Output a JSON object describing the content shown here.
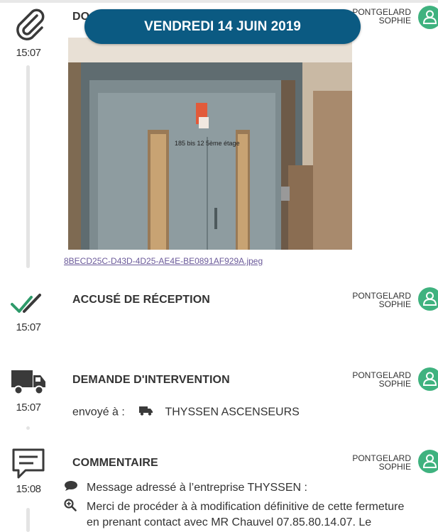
{
  "date_banner": "VENDREDI 14 JUIN 2019",
  "entries": [
    {
      "icon": "paperclip-icon",
      "time": "15:07",
      "title": "DO",
      "author_line1": "PONTGELARD",
      "author_line2": "SOPHIE",
      "attachment_name": "8BECD25C-D43D-4D25-AE4E-BE0891AF929A.jpeg",
      "photo_caption": "185 bis 12 5ème étage"
    },
    {
      "icon": "double-check-icon",
      "time": "15:07",
      "title": "ACCUSÉ DE RÉCEPTION",
      "author_line1": "PONTGELARD",
      "author_line2": "SOPHIE"
    },
    {
      "icon": "truck-icon",
      "time": "15:07",
      "title": "DEMANDE D'INTERVENTION",
      "author_line1": "PONTGELARD",
      "author_line2": "SOPHIE",
      "sent_label": "envoyé à  :",
      "recipient": "THYSSEN ASCENSEURS"
    },
    {
      "icon": "comment-icon",
      "time": "15:08",
      "title": "COMMENTAIRE",
      "author_line1": "PONTGELARD",
      "author_line2": "SOPHIE",
      "message_line": "Message adressé à l’entreprise THYSSEN :",
      "body_line1": "Merci de procéder à à modification définitive de cette fermeture",
      "body_line2": "en prenant contact avec MR Chauvel 07.85.80.14.07. Le"
    }
  ],
  "colors": {
    "banner": "#0b5a82",
    "avatar": "#3fb27f",
    "check": "#2e9a6a",
    "icon": "#3a3a3a"
  }
}
